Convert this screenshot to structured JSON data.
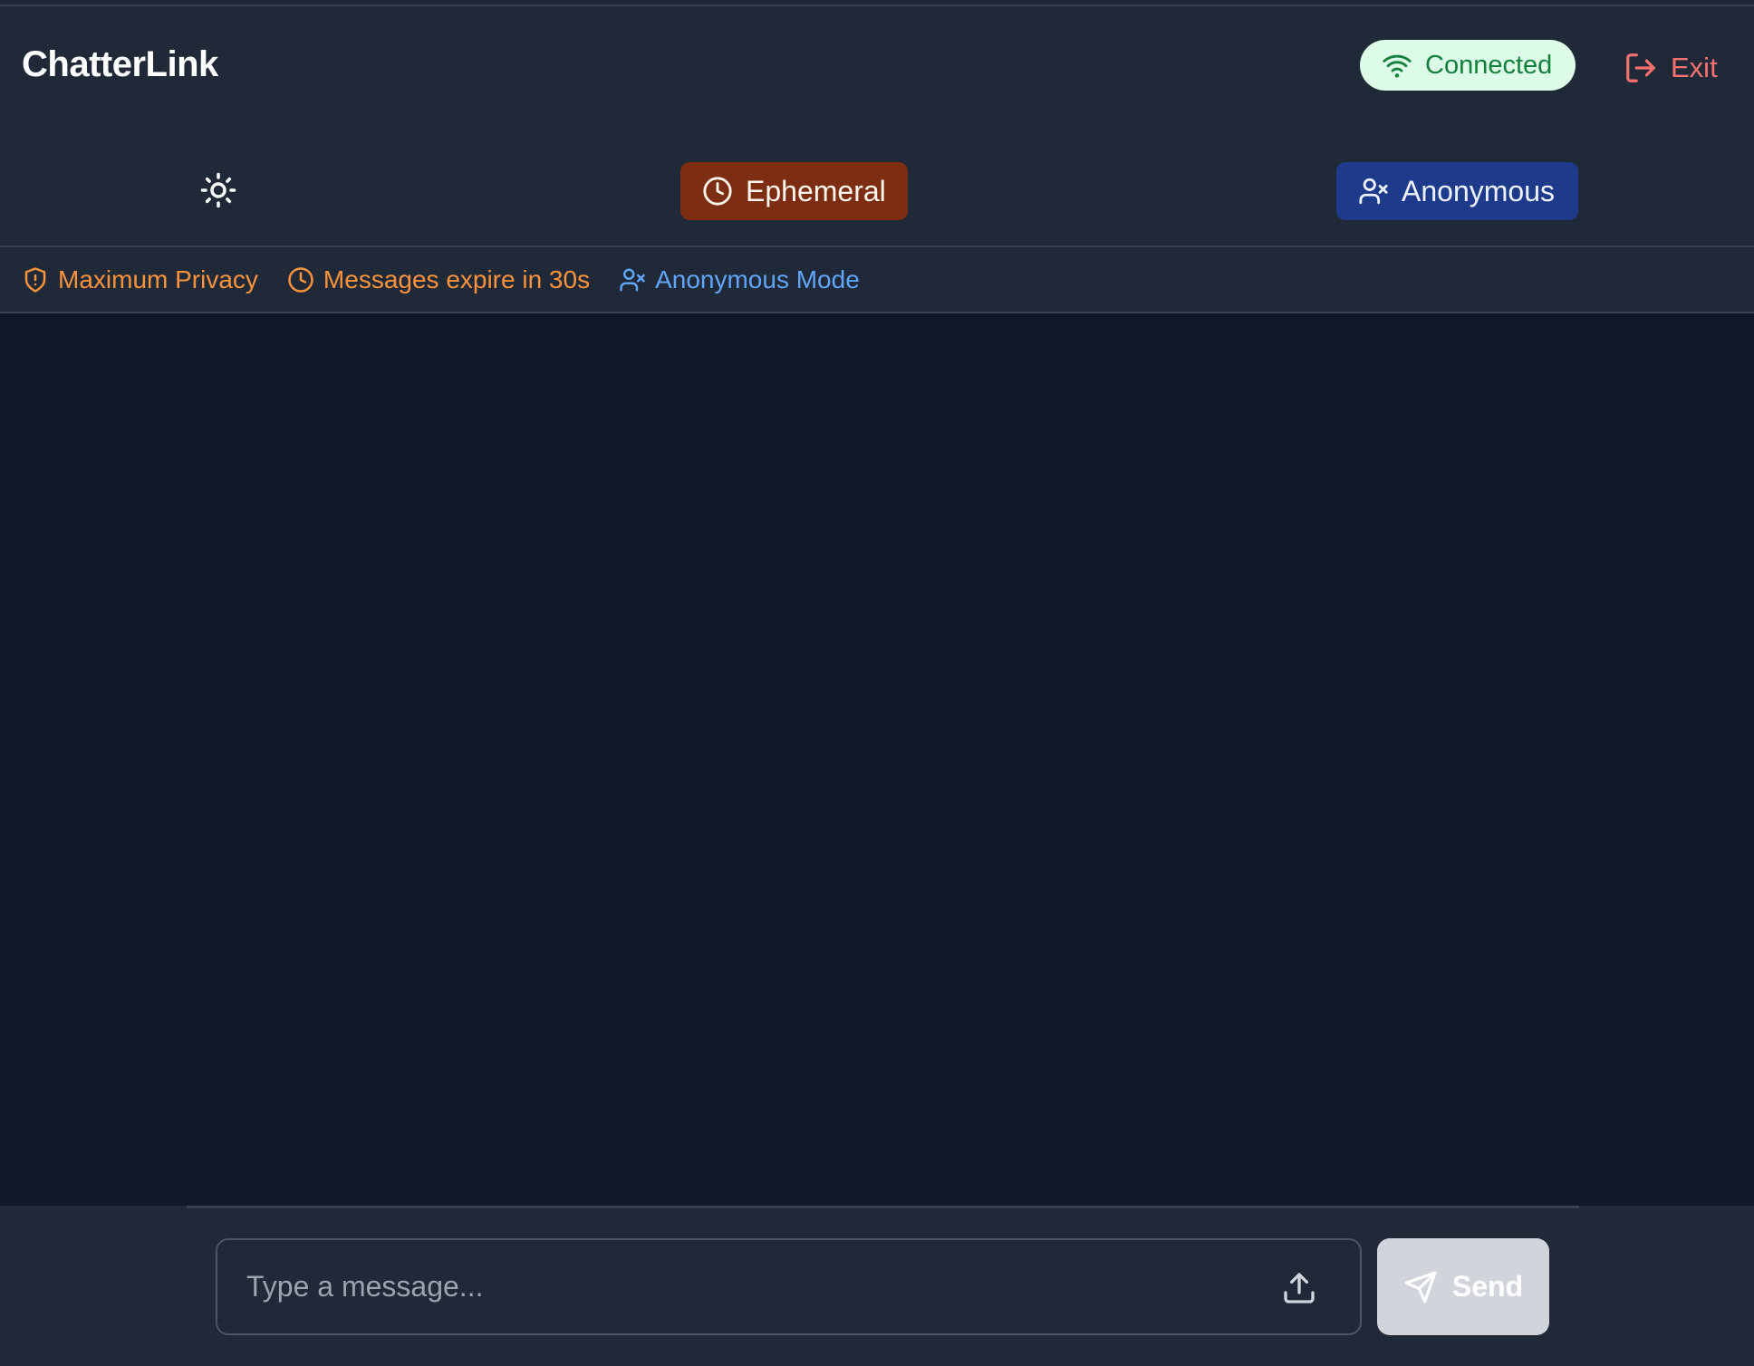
{
  "header": {
    "brand": "ChatterLink",
    "status_label": "Connected",
    "exit_label": "Exit",
    "theme_icon": "sun-icon",
    "modes": [
      {
        "label": "Ephemeral",
        "icon": "clock-icon",
        "color": "#7c2d12"
      },
      {
        "label": "Anonymous",
        "icon": "user-x-icon",
        "color": "#1e3a8a"
      }
    ]
  },
  "privacy_bar": {
    "items": [
      {
        "label": "Maximum Privacy",
        "icon": "shield-alert-icon",
        "color": "#fb923c"
      },
      {
        "label": "Messages expire in 30s",
        "icon": "clock-icon",
        "color": "#fb923c"
      },
      {
        "label": "Anonymous Mode",
        "icon": "user-x-icon",
        "color": "#60a5fa"
      }
    ]
  },
  "messages": [],
  "composer": {
    "value": "",
    "placeholder": "Type a message...",
    "upload_icon": "upload-icon",
    "send_label": "Send"
  },
  "colors": {
    "background": "#111827",
    "panel": "#1f2937",
    "connected_bg": "#dcfce7",
    "connected_text": "#15803d",
    "exit": "#f87171",
    "send_disabled": "#d1d5db"
  }
}
